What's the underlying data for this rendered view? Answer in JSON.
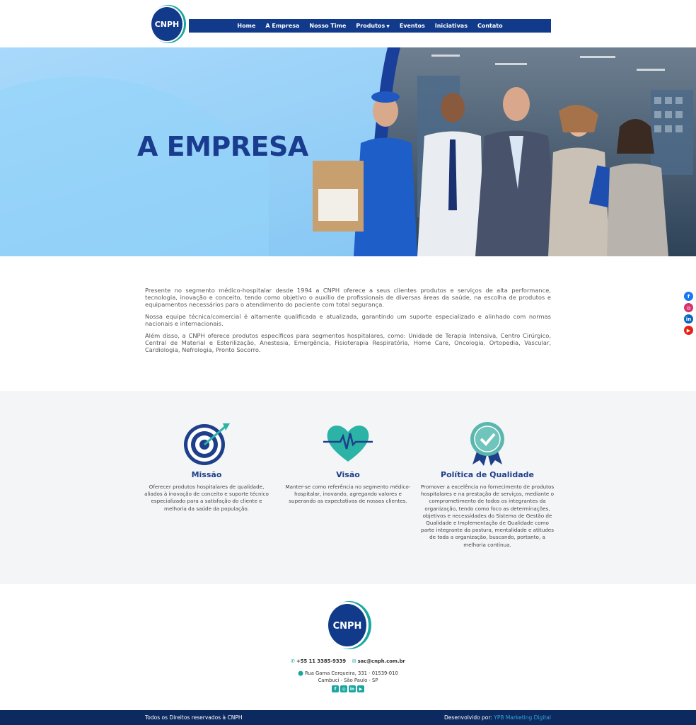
{
  "header": {
    "logo_text": "CNPH",
    "nav": [
      {
        "label": "Home"
      },
      {
        "label": "A Empresa"
      },
      {
        "label": "Nosso Time"
      },
      {
        "label": "Produtos"
      },
      {
        "label": "Eventos"
      },
      {
        "label": "Iniciativas"
      },
      {
        "label": "Contato"
      }
    ]
  },
  "hero": {
    "title": "A EMPRESA"
  },
  "intro": {
    "p1": "Presente no segmento médico-hospitalar desde 1994 a CNPH oferece a seus clientes produtos e serviços de alta performance, tecnologia, inovação e conceito, tendo como objetivo o auxílio de profissionais de diversas áreas da saúde, na escolha de produtos e equipamentos necessários para o atendimento do paciente com total segurança.",
    "p2": "Nossa equipe técnica/comercial é altamente qualificada e atualizada, garantindo um suporte especializado e alinhado com normas nacionais e internacionais.",
    "p3": "Além disso, a CNPH oferece produtos específicos para segmentos hospitalares, como: Unidade de Terapia Intensiva, Centro Cirúrgico, Central de Material e Esterilização, Anestesia, Emergência, Fisioterapia Respiratória, Home Care, Oncologia, Ortopedia, Vascular, Cardiologia, Nefrologia, Pronto Socorro."
  },
  "values": [
    {
      "title": "Missão",
      "text": "Oferecer produtos hospitalares de qualidade, aliados à inovação de conceito e suporte técnico especializado para a satisfação do cliente e melhoria da saúde da população.",
      "icon": "target-icon"
    },
    {
      "title": "Visão",
      "text": "Manter-se como referência no segmento médico-hospitalar, inovando, agregando valores e superando as expectativas de nossos clientes.",
      "icon": "heart-pulse-icon"
    },
    {
      "title": "Política de Qualidade",
      "text": "Promover a excelência no fornecimento de produtos hospitalares e na prestação de serviços, mediante o comprometimento de todos os integrantes da organização, tendo como foco as determinações, objetivos e necessidades do Sistema de Gestão de Qualidade e Implementação de Qualidade como parte integrante da postura, mentalidade e atitudes de toda a organização, buscando, portanto, a melhoria contínua.",
      "icon": "quality-badge-icon"
    }
  ],
  "footer": {
    "logo_text": "CNPH",
    "phone": "+55 11 3385-9339",
    "email": "sac@cnph.com.br",
    "address_line1": "Rua Gama Cerqueira, 331 - 01539-010",
    "address_line2": "Cambuci - São Paulo - SP",
    "copyright": "Todos os Direitos reservados à CNPH",
    "dev_label": "Desenvolvido por:",
    "dev_name": "YPB Marketing Digital"
  },
  "colors": {
    "brand_blue": "#123a8a",
    "teal": "#1aa6a0",
    "hero_bg": "#8ccff8",
    "footer_bar": "#0c2a5f"
  }
}
